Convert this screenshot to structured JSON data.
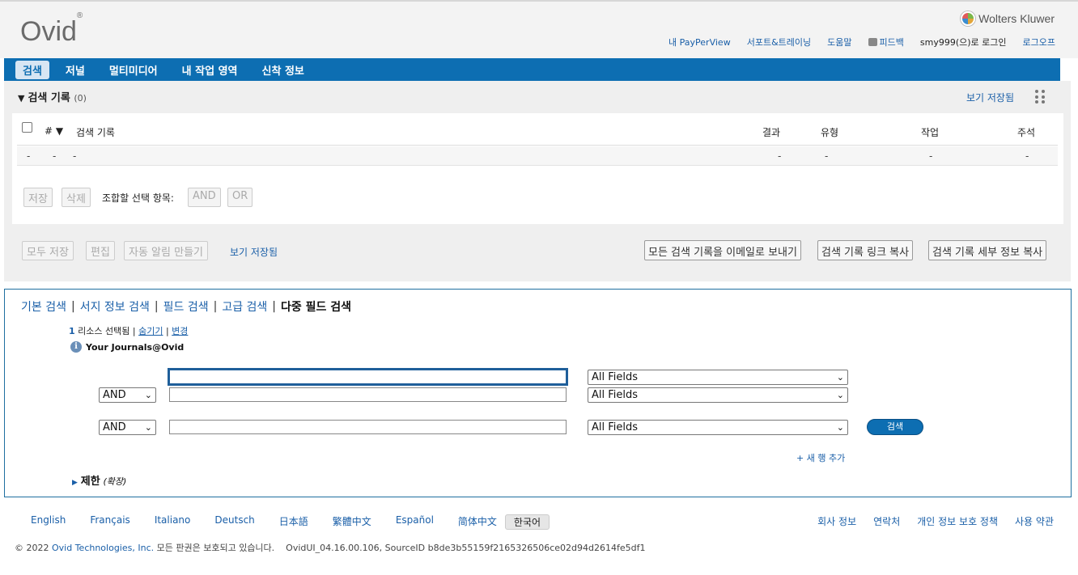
{
  "header": {
    "logo_text": "Ovid",
    "logo_mark": "®",
    "brand_right": "Wolters Kluwer",
    "util_links": [
      "내 PayPerView",
      "서포트&트레이닝",
      "도움말",
      "피드백"
    ],
    "login_text": "smy999(으)로 로그인",
    "logout": "로그오프"
  },
  "nav": {
    "items": [
      "검색",
      "저널",
      "멀티미디어",
      "내 작업 영역",
      "신착 정보"
    ],
    "active_index": 0
  },
  "history": {
    "title": "검색 기록",
    "count": "(0)",
    "view_saved": "보기 저장됨",
    "columns": [
      "#",
      "검색 기록",
      "결과",
      "유형",
      "작업",
      "주석"
    ],
    "row": [
      "-",
      "-",
      "-",
      "-",
      "-",
      "-",
      "-"
    ],
    "btn_save": "저장",
    "btn_delete": "삭제",
    "combine_label": "조합할 선택 항목:",
    "btn_and": "AND",
    "btn_or": "OR",
    "btn_save_all": "모두 저장",
    "btn_edit": "편집",
    "btn_alert": "자동 알림 만들기",
    "link_view_saved": "보기 저장됨",
    "btn_email": "모든 검색 기록을 이메일로 보내기",
    "btn_copy_link": "검색 기록 링크 복사",
    "btn_copy_detail": "검색 기록 세부 정보 복사"
  },
  "search": {
    "tabs": [
      "기본 검색",
      "서지 정보 검색",
      "필드 검색",
      "고급 검색",
      "다중 필드 검색"
    ],
    "current_tab_index": 4,
    "resource_count": "1",
    "resource_selected": "리소스 선택됨",
    "hide": "숨기기",
    "change": "변경",
    "journal_name": "Your Journals@Ovid",
    "rows": [
      {
        "operator": "",
        "value": "",
        "field": "All Fields"
      },
      {
        "operator": "AND",
        "value": "",
        "field": "All Fields"
      },
      {
        "operator": "AND",
        "value": "",
        "field": "All Fields"
      }
    ],
    "search_button": "검색",
    "add_row": "+ 새 행 추가",
    "limit_label": "제한",
    "limit_expand": "(확장)"
  },
  "footer": {
    "languages": [
      "English",
      "Français",
      "Italiano",
      "Deutsch",
      "日本語",
      "繁體中文",
      "Español",
      "简体中文"
    ],
    "current_language": "한국어",
    "links": [
      "회사 정보",
      "연락처",
      "개인 정보 보호 정책",
      "사용 약관"
    ],
    "copyright_prefix": "© 2022",
    "company": "Ovid Technologies, Inc.",
    "rights": "모든 판권은 보호되고 있습니다.",
    "build": "OvidUI_04.16.00.106, SourceID b8de3b55159f2165326506ce02d94d2614fe5df1"
  },
  "colors": {
    "nav_bg": "#0d6eb2",
    "link": "#1a5fa8",
    "search_btn": "#0d6eb2"
  }
}
